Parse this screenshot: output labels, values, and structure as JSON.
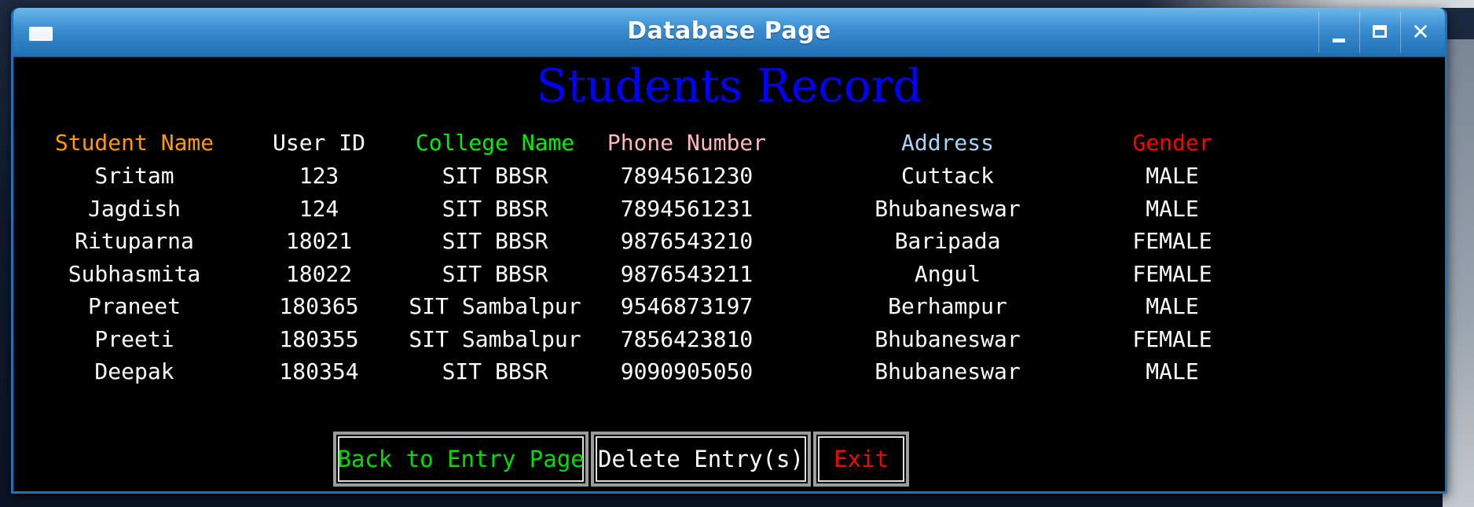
{
  "window": {
    "title": "Database Page"
  },
  "heading": "Students Record",
  "table": {
    "columns": [
      {
        "label": "Student Name",
        "color": "#ff9900"
      },
      {
        "label": "User ID",
        "color": "#ffffff"
      },
      {
        "label": "College Name",
        "color": "#00ee00"
      },
      {
        "label": "Phone Number",
        "color": "#ffb6c1"
      },
      {
        "label": "Address",
        "color": "#a8d4f5"
      },
      {
        "label": "Gender",
        "color": "#ff0000"
      }
    ],
    "rows": [
      [
        "Sritam",
        "123",
        "SIT BBSR",
        "7894561230",
        "Cuttack",
        "MALE"
      ],
      [
        "Jagdish",
        "124",
        "SIT BBSR",
        "7894561231",
        "Bhubaneswar",
        "MALE"
      ],
      [
        "Rituparna",
        "18021",
        "SIT BBSR",
        "9876543210",
        "Baripada",
        "FEMALE"
      ],
      [
        "Subhasmita",
        "18022",
        "SIT BBSR",
        "9876543211",
        "Angul",
        "FEMALE"
      ],
      [
        "Praneet",
        "180365",
        "SIT Sambalpur",
        "9546873197",
        "Berhampur",
        "MALE"
      ],
      [
        "Preeti",
        "180355",
        "SIT Sambalpur",
        "7856423810",
        "Bhubaneswar",
        "FEMALE"
      ],
      [
        "Deepak",
        "180354",
        "SIT BBSR",
        "9090905050",
        "Bhubaneswar",
        "MALE"
      ]
    ]
  },
  "buttons": {
    "back": {
      "label": "Back to Entry Page",
      "color": "#00dd00"
    },
    "delete": {
      "label": "Delete Entry(s)",
      "color": "#ffffff"
    },
    "exit": {
      "label": "Exit",
      "color": "#ff0000"
    }
  },
  "icons": {
    "window_menu": "window-menu-icon",
    "minimize": "minimize-icon",
    "maximize": "maximize-icon",
    "close": "close-icon"
  }
}
